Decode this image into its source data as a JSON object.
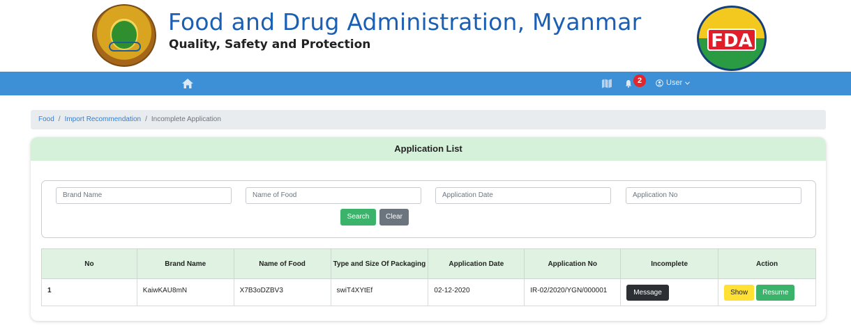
{
  "header": {
    "title": "Food and Drug Administration, Myanmar",
    "subtitle": "Quality, Safety and Protection",
    "logo_right_text": "FDA"
  },
  "navbar": {
    "notification_count": "2",
    "user_label": "User"
  },
  "breadcrumb": {
    "items": [
      "Food",
      "Import Recommendation",
      "Incomplete Application"
    ]
  },
  "card": {
    "title": "Application List"
  },
  "search": {
    "brand_placeholder": "Brand Name",
    "food_placeholder": "Name of Food",
    "date_placeholder": "Application Date",
    "appno_placeholder": "Application No",
    "search_label": "Search",
    "clear_label": "Clear"
  },
  "table": {
    "headers": [
      "No",
      "Brand Name",
      "Name of Food",
      "Type and Size Of Packaging",
      "Application Date",
      "Application No",
      "Incomplete",
      "Action"
    ],
    "rows": [
      {
        "no": "1",
        "brand": "KaiwKAU8mN",
        "food": "X7B3oDZBV3",
        "packaging": "swiT4XYtEf",
        "date": "02-12-2020",
        "appno": "IR-02/2020/YGN/000001",
        "message_label": "Message",
        "show_label": "Show",
        "resume_label": "Resume"
      }
    ]
  },
  "colors": {
    "navbar": "#3d8fd6",
    "card_header": "#d5f1d9",
    "primary_text": "#1a5fb4",
    "success": "#3bb36a",
    "warning": "#ffe135",
    "danger": "#e3262e"
  }
}
